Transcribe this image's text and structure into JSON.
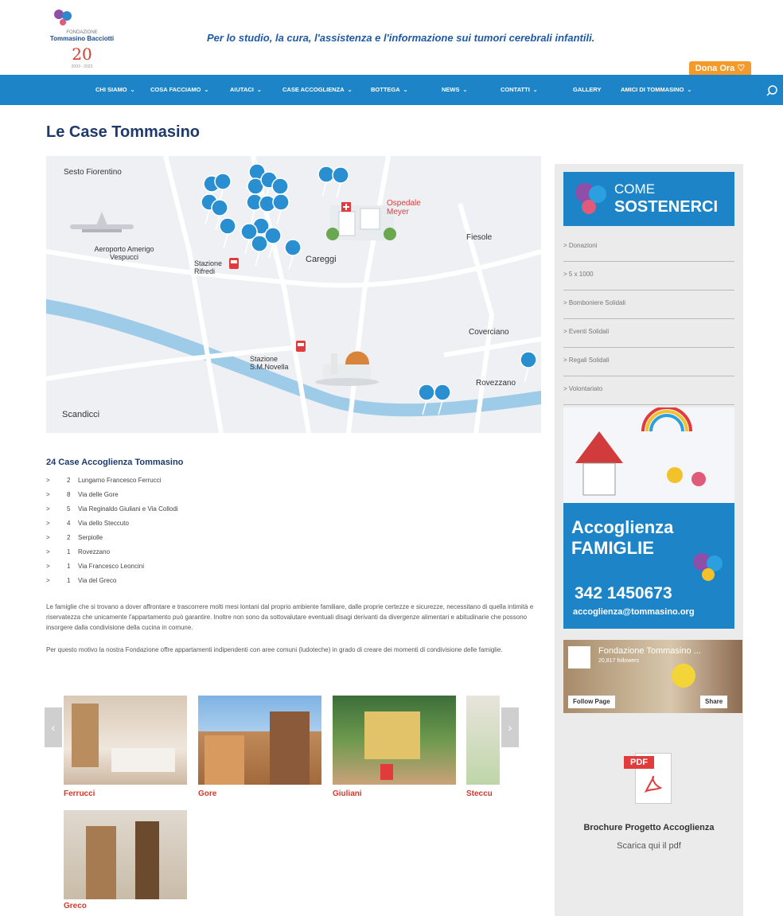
{
  "header": {
    "logo_fund": "FONDAZIONE",
    "logo_name": "Tommasino Bacciotti",
    "logo_anni": "20",
    "logo_years": "2003 - 2023",
    "tagline": "Per lo studio, la cura, l'assistenza e l'informazione sui tumori cerebrali infantili.",
    "dona_label": "Dona Ora ♡"
  },
  "nav": [
    {
      "label": "CHI SIAMO",
      "chev": "⌄"
    },
    {
      "label": "COSA FACCIAMO",
      "chev": "⌄"
    },
    {
      "label": "AIUTACI",
      "chev": "⌄"
    },
    {
      "label": "CASE ACCOGLIENZA",
      "chev": "⌄"
    },
    {
      "label": "BOTTEGA",
      "chev": "⌄"
    },
    {
      "label": "NEWS",
      "chev": "⌄"
    },
    {
      "label": "CONTATTI",
      "chev": "⌄"
    },
    {
      "label": "GALLERY",
      "chev": ""
    },
    {
      "label": "AMICI DI TOMMASINO",
      "chev": "⌄"
    }
  ],
  "page_title": "Le Case Tommasino",
  "map": {
    "labels": [
      "Sesto Fiorentino",
      "Aeroporto Amerigo Vespucci",
      "Stazione Rifredi",
      "Careggi",
      "Ospedale Meyer",
      "Fiesole",
      "Coverciano",
      "Stazione S.M.Novella",
      "Rovezzano",
      "Scandicci"
    ]
  },
  "list_title": "24 Case Accoglienza Tommasino",
  "houses": [
    {
      "n": "2",
      "t": "Lungarno Francesco Ferrucci"
    },
    {
      "n": "8",
      "t": "Via delle Gore"
    },
    {
      "n": "5",
      "t": "Via Reginaldo Giuliani e Via Collodi"
    },
    {
      "n": "4",
      "t": "Via dello Steccuto"
    },
    {
      "n": "2",
      "t": "Serpiolle"
    },
    {
      "n": "1",
      "t": "Rovezzano"
    },
    {
      "n": "1",
      "t": "Via Francesco Leoncini"
    },
    {
      "n": "1",
      "t": "Via del Greco"
    }
  ],
  "para1": "Le famiglie che si trovano a dover affrontare e trascorrere molti mesi lontani dal proprio ambiente familiare, dalle proprie certezze e sicurezze, necessitano di quella intimità e riservatezza che unicamente l'appartamento può garantire. Inoltre non sono da sottovalutare eventuali disagi derivanti da divergenze alimentari e abitudinarie che possono insorgere dalla condivisione della cucina in comune.",
  "para2": "Per questo motivo la nostra Fondazione offre appartamenti indipendenti con aree comuni (ludoteche) in grado di creare dei momenti di condivisione delle famiglie.",
  "carousel": {
    "prev": "‹",
    "next": "›",
    "items": [
      "Ferrucci",
      "Gore",
      "Giuliani",
      "Steccu",
      "Greco"
    ]
  },
  "sidebar": {
    "come": "COME",
    "sostenerci": "SOSTENERCI",
    "links": [
      "> Donazioni",
      "> 5 x 1000",
      "> Bomboniere Solidali",
      "> Eventi Solidali",
      "> Regali Solidali",
      "> Volontariato"
    ],
    "acco_line1": "Accoglienza",
    "acco_line2": "FAMIGLIE",
    "acco_phone": "342 1450673",
    "acco_email": "accoglienza@tommasino.org",
    "fb_name": "Fondazione Tommasino ...",
    "fb_followers": "20,817 followers",
    "fb_follow": "Follow Page",
    "fb_share": "Share",
    "pdf_label": "PDF",
    "brochure_title": "Brochure Progetto Accoglienza",
    "brochure_link": "Scarica qui il pdf"
  },
  "colors": {
    "nav": "#1e84c8",
    "title": "#1d3a6b",
    "accent": "#d33a2c",
    "dona": "#f39a2a"
  }
}
